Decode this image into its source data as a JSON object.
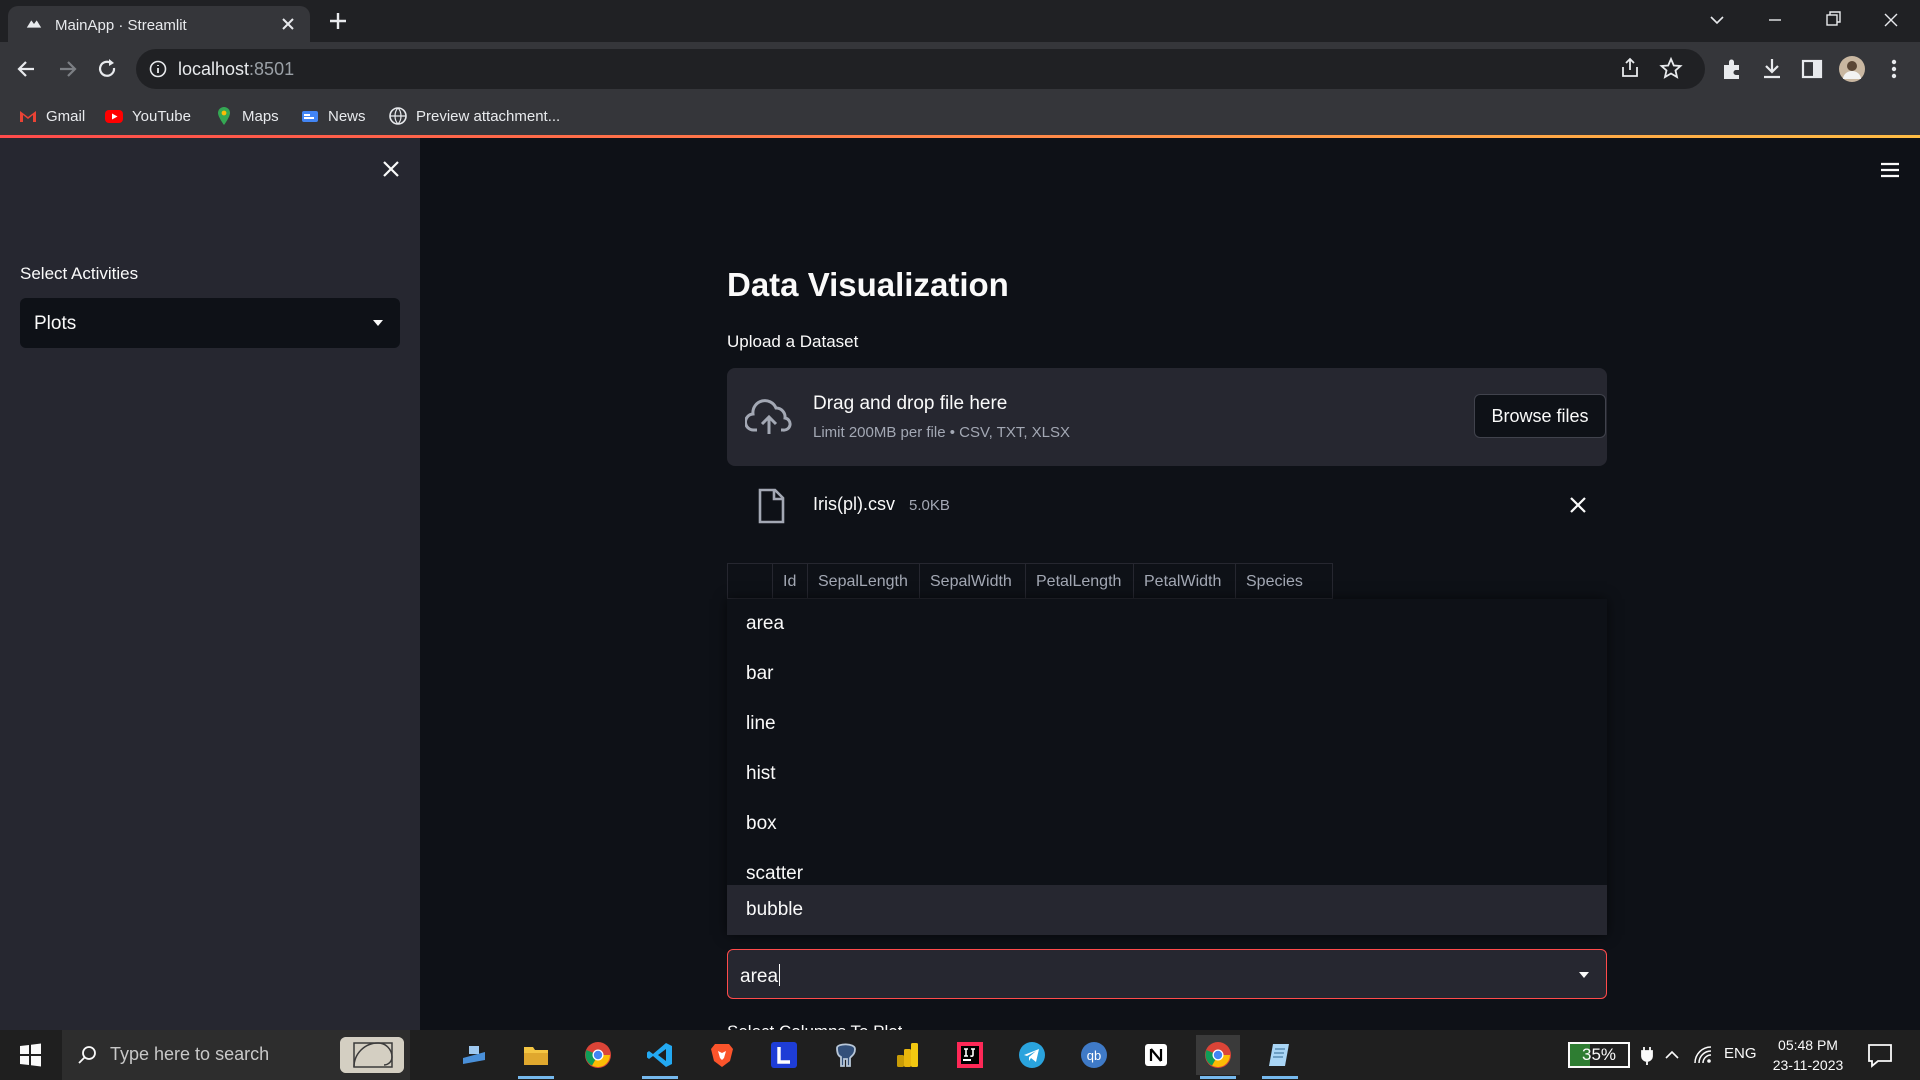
{
  "browser": {
    "tab_title": "MainApp · Streamlit",
    "url_host": "localhost",
    "url_port": ":8501",
    "bookmarks": [
      {
        "label": "Gmail",
        "icon": "gmail-icon"
      },
      {
        "label": "YouTube",
        "icon": "youtube-icon"
      },
      {
        "label": "Maps",
        "icon": "maps-icon"
      },
      {
        "label": "News",
        "icon": "news-icon"
      },
      {
        "label": "Preview attachment...",
        "icon": "globe-icon"
      }
    ]
  },
  "sidebar": {
    "label": "Select Activities",
    "select_value": "Plots"
  },
  "main": {
    "title": "Data Visualization",
    "upload_label": "Upload a Dataset",
    "dropzone": {
      "title": "Drag and drop file here",
      "limit": "Limit 200MB per file • CSV, TXT, XLSX",
      "browse_label": "Browse files"
    },
    "file": {
      "name": "Iris(pl).csv",
      "size": "5.0KB"
    },
    "table_columns": [
      "",
      "Id",
      "SepalLength",
      "SepalWidth",
      "PetalLength",
      "PetalWidth",
      "Species"
    ],
    "plot_options": [
      "area",
      "bar",
      "line",
      "hist",
      "box",
      "scatter",
      "bubble"
    ],
    "hovered_option": "bubble",
    "select_input_value": "area",
    "next_label": "Select Columns To Plot"
  },
  "taskbar": {
    "search_placeholder": "Type here to search",
    "battery": "35%",
    "battery_level": 0.35,
    "language": "ENG",
    "time": "05:48 PM",
    "date": "23-11-2023"
  },
  "colors": {
    "accent": "#ff4b4b",
    "sidebar_bg": "#262730",
    "main_bg": "#0e1117"
  }
}
